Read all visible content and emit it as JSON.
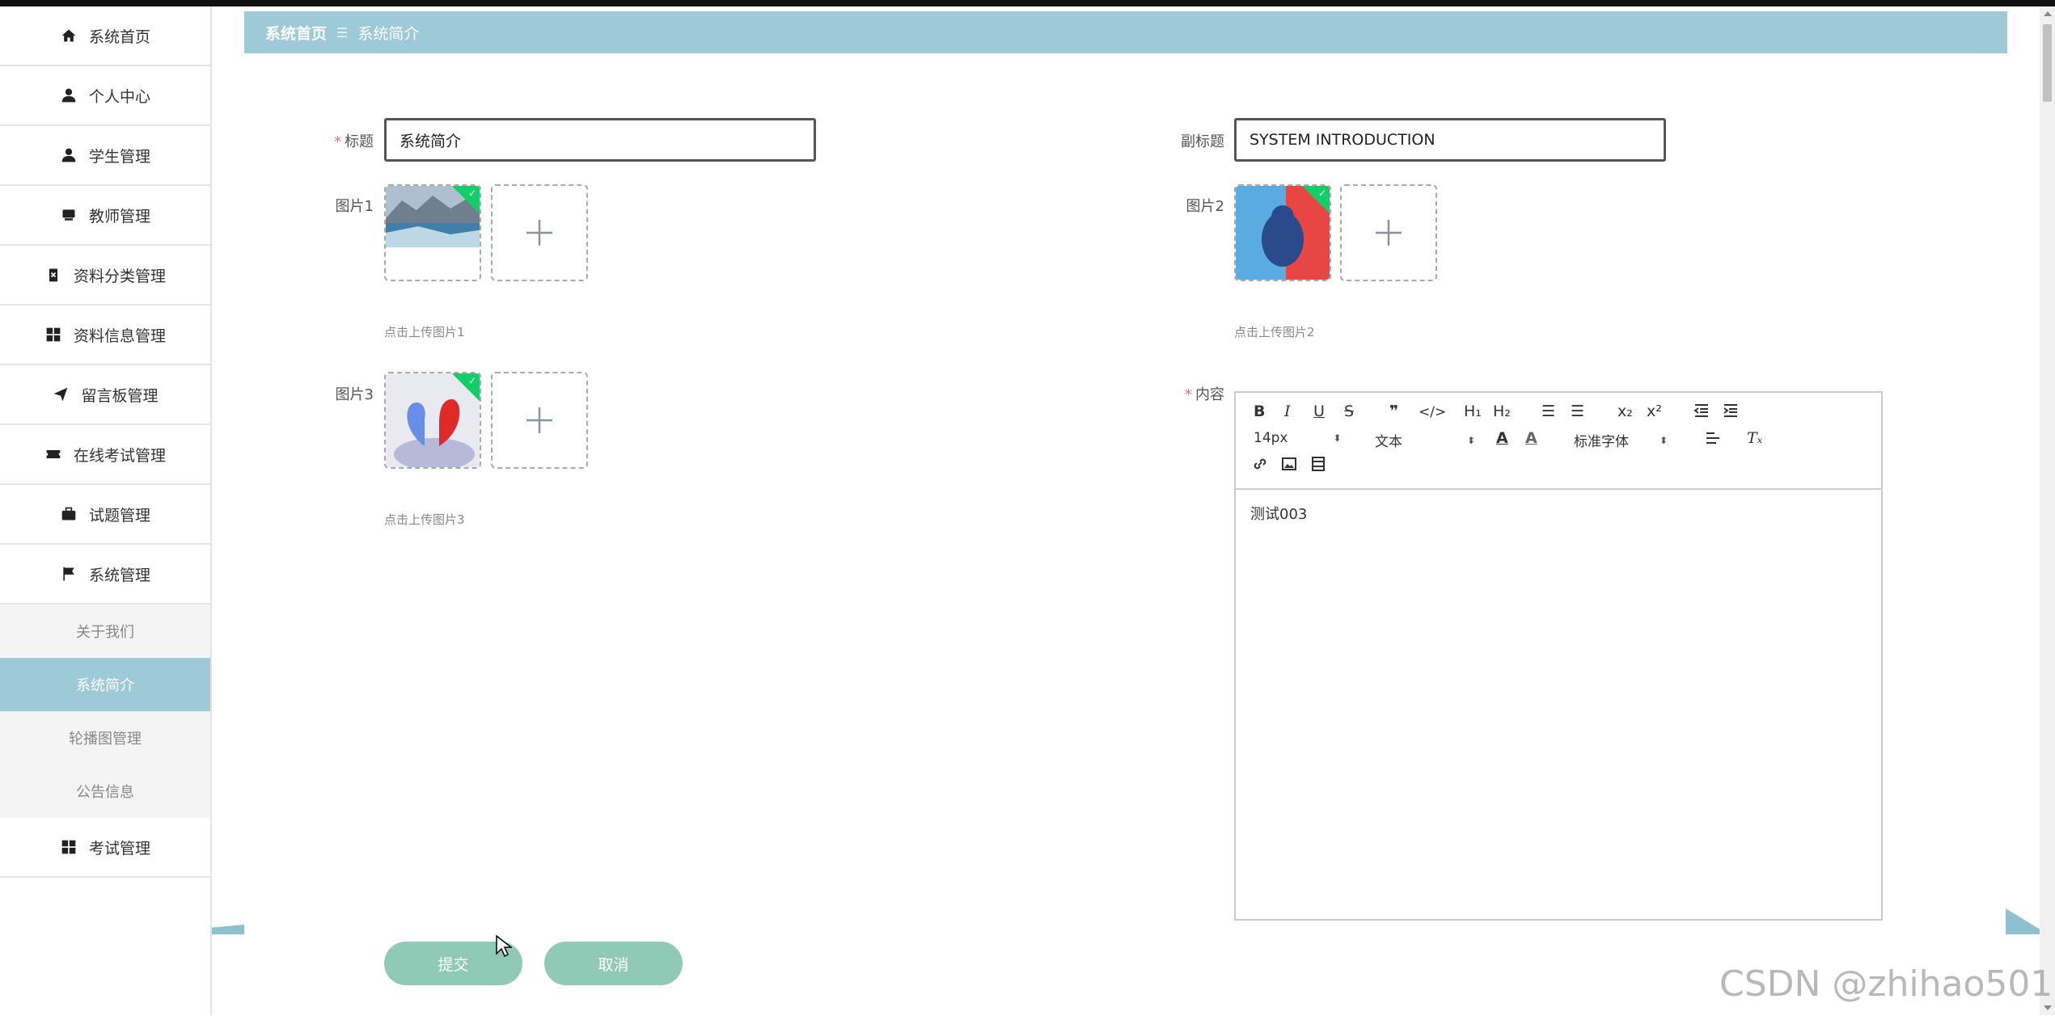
{
  "sidebar": {
    "items": [
      {
        "label": "系统首页",
        "icon": "home-icon"
      },
      {
        "label": "个人中心",
        "icon": "user-icon"
      },
      {
        "label": "学生管理",
        "icon": "user-icon"
      },
      {
        "label": "教师管理",
        "icon": "monitor-icon"
      },
      {
        "label": "资料分类管理",
        "icon": "clipboard-icon"
      },
      {
        "label": "资料信息管理",
        "icon": "grid-icon"
      },
      {
        "label": "留言板管理",
        "icon": "send-icon"
      },
      {
        "label": "在线考试管理",
        "icon": "ticket-icon"
      },
      {
        "label": "试题管理",
        "icon": "briefcase-icon"
      },
      {
        "label": "系统管理",
        "icon": "flag-icon"
      }
    ],
    "sub_items": [
      {
        "label": "关于我们"
      },
      {
        "label": "系统简介"
      },
      {
        "label": "轮播图管理"
      },
      {
        "label": "公告信息"
      }
    ],
    "active_sub": "系统简介",
    "last_item": {
      "label": "考试管理",
      "icon": "grid-icon"
    }
  },
  "breadcrumb": {
    "home": "系统首页",
    "separator": "☰",
    "current": "系统简介"
  },
  "form": {
    "title_label": "标题",
    "title_value": "系统简介",
    "subtitle_label": "副标题",
    "subtitle_value": "SYSTEM INTRODUCTION",
    "image1_label": "图片1",
    "image1_hint": "点击上传图片1",
    "image2_label": "图片2",
    "image2_hint": "点击上传图片2",
    "image3_label": "图片3",
    "image3_hint": "点击上传图片3",
    "content_label": "内容",
    "content_value": "测试003",
    "submit_label": "提交",
    "cancel_label": "取消"
  },
  "editor": {
    "font_size": "14px",
    "header_select": "文本",
    "font_family": "标准字体",
    "bold": "B",
    "italic": "I",
    "underline": "U",
    "strike": "S",
    "quote": "❞",
    "code": "</>",
    "h1": "H₁",
    "h2": "H₂",
    "ordered_list": "☰",
    "bullet_list": "☰",
    "subscript": "x₂",
    "superscript": "x²",
    "text_color": "A",
    "bg_color": "A",
    "clean": "Tₓ"
  },
  "watermark": "CSDN @zhihao501",
  "colors": {
    "accent": "#9ecad8",
    "button": "#91c9b7",
    "required": "#f56c6c",
    "badge": "#13ce66"
  }
}
